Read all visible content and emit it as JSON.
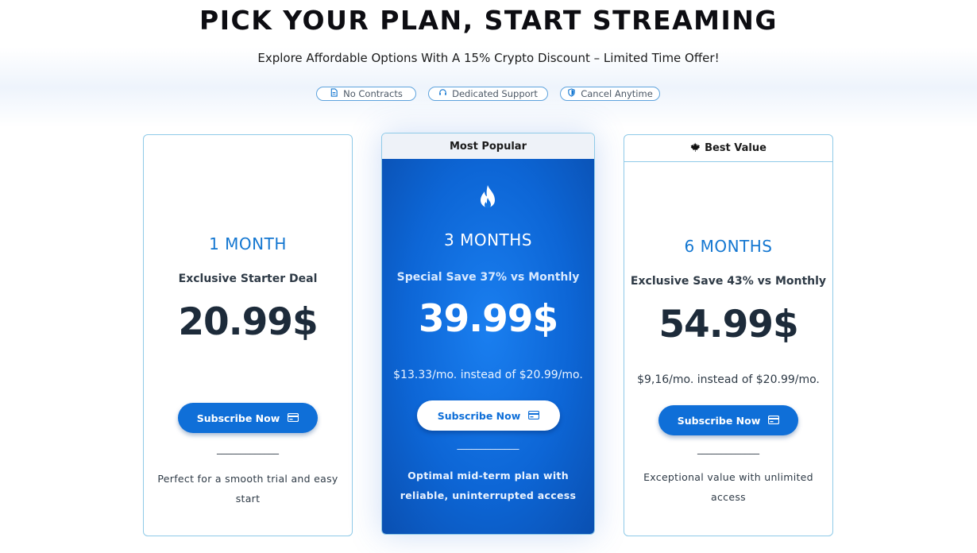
{
  "header": {
    "title": "PICK YOUR PLAN, START STREAMING",
    "subtitle": "Explore Affordable Options With A 15% Crypto Discount – Limited Time Offer!"
  },
  "badges": [
    {
      "label": "No Contracts",
      "icon": "document-icon"
    },
    {
      "label": "Dedicated Support",
      "icon": "headset-icon"
    },
    {
      "label": "Cancel Anytime",
      "icon": "shield-icon"
    }
  ],
  "plans": [
    {
      "name": "1 MONTH",
      "deal": "Exclusive Starter Deal",
      "price": "20.99$",
      "per_month": "",
      "button": "Subscribe Now",
      "divider": "_____________",
      "description": "Perfect for a smooth trial and easy start"
    },
    {
      "ribbon": "Most Popular",
      "icon": "flame-icon",
      "name": "3 MONTHS",
      "deal": "Special Save 37% vs Monthly",
      "price": "39.99$",
      "per_month": "$13.33/mo. instead of $20.99/mo.",
      "button": "Subscribe Now",
      "divider": "_____________",
      "description": "Optimal mid-term plan with reliable, uninterrupted access"
    },
    {
      "ribbon": "Best Value",
      "ribbon_icon": "maple-leaf-icon",
      "name": "6 MONTHS",
      "deal": "Exclusive Save 43% vs Monthly",
      "price": "54.99$",
      "per_month": "$9,16/mo. instead of $20.99/mo.",
      "button": "Subscribe Now",
      "divider": "_____________",
      "description": "Exceptional value with unlimited access"
    }
  ],
  "colors": {
    "accent": "#0f6fd8",
    "plan_title": "#1477d1",
    "card_border": "#8fcae8",
    "popular_bg": "#0d66d6"
  }
}
